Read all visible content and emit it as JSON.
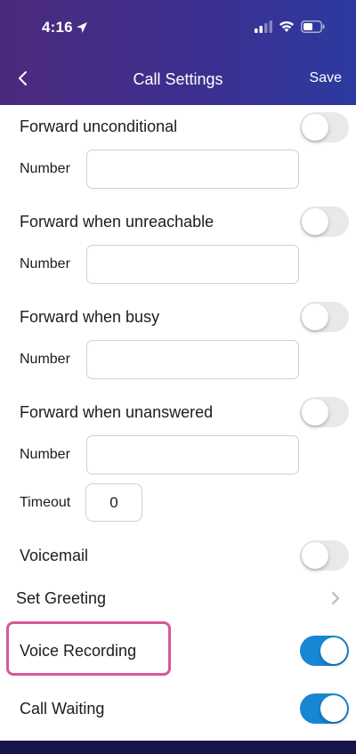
{
  "status_bar": {
    "time": "4:16"
  },
  "nav": {
    "back_icon": "chevron-left-icon",
    "title": "Call Settings",
    "save_label": "Save"
  },
  "forward_unconditional": {
    "label": "Forward unconditional",
    "enabled": false,
    "number_label": "Number",
    "number_value": ""
  },
  "forward_unreachable": {
    "label": "Forward when unreachable",
    "enabled": false,
    "number_label": "Number",
    "number_value": ""
  },
  "forward_busy": {
    "label": "Forward when busy",
    "enabled": false,
    "number_label": "Number",
    "number_value": ""
  },
  "forward_unanswered": {
    "label": "Forward when unanswered",
    "enabled": false,
    "number_label": "Number",
    "number_value": "",
    "timeout_label": "Timeout",
    "timeout_value": "0"
  },
  "voicemail": {
    "label": "Voicemail",
    "enabled": false
  },
  "set_greeting": {
    "label": "Set Greeting",
    "icon": "chevron-right-icon"
  },
  "voice_recording": {
    "label": "Voice Recording",
    "enabled": true,
    "highlight_color": "#d6589a"
  },
  "call_waiting": {
    "label": "Call Waiting",
    "enabled": true
  },
  "colors": {
    "header_start": "#4b2a7d",
    "header_end": "#2c3aa0",
    "toggle_on": "#1786d3",
    "toggle_off": "#e9e9ea"
  }
}
